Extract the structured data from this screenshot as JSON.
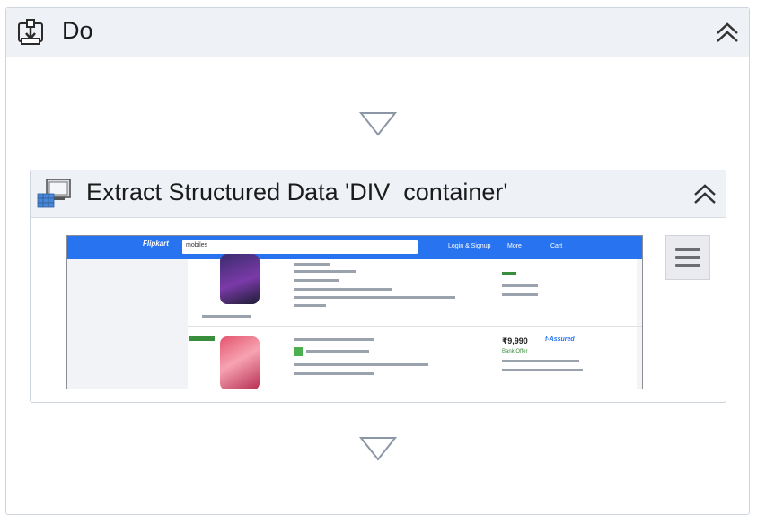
{
  "sequence": {
    "title": "Do"
  },
  "activity": {
    "title": "Extract Structured Data 'DIV  container'"
  },
  "icons": {
    "sequence": "sequence-icon",
    "activity": "extract-data-icon",
    "collapse": "chevron-double-up-icon",
    "drop": "drop-arrow-icon",
    "menu": "hamburger-menu-icon"
  },
  "preview": {
    "brand": "Flipkart",
    "search_value": "mobiles",
    "nav": [
      "Login & Signup",
      "More",
      "Cart"
    ],
    "products": [
      {
        "price": "",
        "offer": "",
        "assured": false
      },
      {
        "price": "₹9,990",
        "offer": "Bank Offer",
        "assured": true
      }
    ]
  },
  "colors": {
    "header_bg": "#eef1f6",
    "border": "#cfd5df",
    "preview_bar": "#2874f0"
  }
}
